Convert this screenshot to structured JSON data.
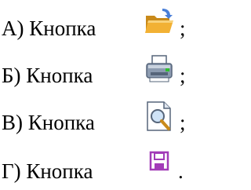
{
  "options": [
    {
      "label": "А) Кнопка",
      "icon": "open-folder-icon",
      "punct": ";"
    },
    {
      "label": "Б) Кнопка",
      "icon": "printer-icon",
      "punct": ";"
    },
    {
      "label": "В) Кнопка",
      "icon": "print-preview-icon",
      "punct": ";"
    },
    {
      "label": "Г) Кнопка",
      "icon": "save-icon",
      "punct": "."
    }
  ],
  "colors": {
    "folder": "#f2b134",
    "folder_dark": "#c98a1a",
    "arrow": "#4a7fd8",
    "printer": "#8c9bb0",
    "printer_dark": "#56657a",
    "led": "#2fbf2f",
    "save": "#a23bb8"
  }
}
